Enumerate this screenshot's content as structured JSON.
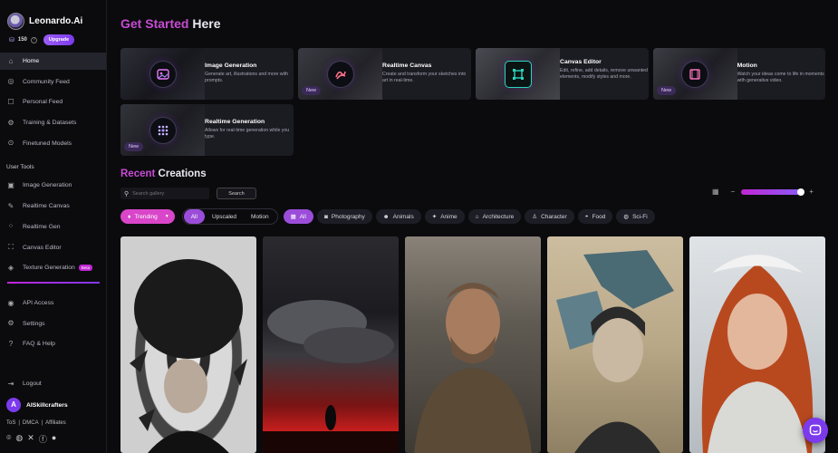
{
  "app": {
    "brand": "Leonardo.Ai",
    "credits": "150",
    "upgrade_label": "Upgrade"
  },
  "sidebar": {
    "items": [
      {
        "label": "Home",
        "icon": "home-icon"
      },
      {
        "label": "Community Feed",
        "icon": "community-icon"
      },
      {
        "label": "Personal Feed",
        "icon": "personal-icon"
      },
      {
        "label": "Training & Datasets",
        "icon": "training-icon"
      },
      {
        "label": "Finetuned Models",
        "icon": "models-icon"
      }
    ],
    "tools_label": "User Tools",
    "tools": [
      {
        "label": "Image Generation",
        "icon": "image-gen-icon"
      },
      {
        "label": "Realtime Canvas",
        "icon": "realtime-canvas-icon"
      },
      {
        "label": "Realtime Gen",
        "icon": "realtime-gen-icon"
      },
      {
        "label": "Canvas Editor",
        "icon": "canvas-editor-icon"
      },
      {
        "label": "Texture Generation",
        "icon": "texture-icon",
        "badge": "Beta"
      }
    ],
    "bottom": [
      {
        "label": "API Access",
        "icon": "api-icon"
      },
      {
        "label": "Settings",
        "icon": "settings-icon"
      },
      {
        "label": "FAQ & Help",
        "icon": "help-icon"
      }
    ],
    "logout_label": "Logout",
    "user": {
      "initial": "A",
      "name": "AISkillcrafters"
    },
    "footer": {
      "tos": "ToS",
      "sep1": "|",
      "dmca": "DMCA",
      "sep2": "|",
      "affiliates": "Affiliates"
    }
  },
  "main": {
    "title_accent": "Get Started",
    "title_rest": " Here",
    "cards": [
      {
        "title": "Image Generation",
        "desc": "Generate art, illustrations and more with prompts.",
        "new": ""
      },
      {
        "title": "Realtime Canvas",
        "desc": "Create and transform your sketches into art in real-time.",
        "new": "New"
      },
      {
        "title": "Canvas Editor",
        "desc": "Edit, refine, add details, remove unwanted elements, modify styles and more.",
        "new": ""
      },
      {
        "title": "Motion",
        "desc": "Watch your ideas come to life in moments with generative video.",
        "new": "New"
      },
      {
        "title": "Realtime Generation",
        "desc": "Allows for real-time generation while you type.",
        "new": "New"
      }
    ],
    "recent_accent": "Recent",
    "recent_rest": " Creations",
    "search_placeholder": "Search gallery",
    "search_button": "Search",
    "filters": {
      "trending": "Trending",
      "modes": [
        "All",
        "Upscaled",
        "Motion"
      ],
      "categories": [
        "All",
        "Photography",
        "Animals",
        "Anime",
        "Architecture",
        "Character",
        "Food",
        "Sci-Fi"
      ]
    },
    "zoom_level": 1.0
  },
  "colors": {
    "accent": "#c74bd3",
    "primary": "#7c3aed"
  }
}
